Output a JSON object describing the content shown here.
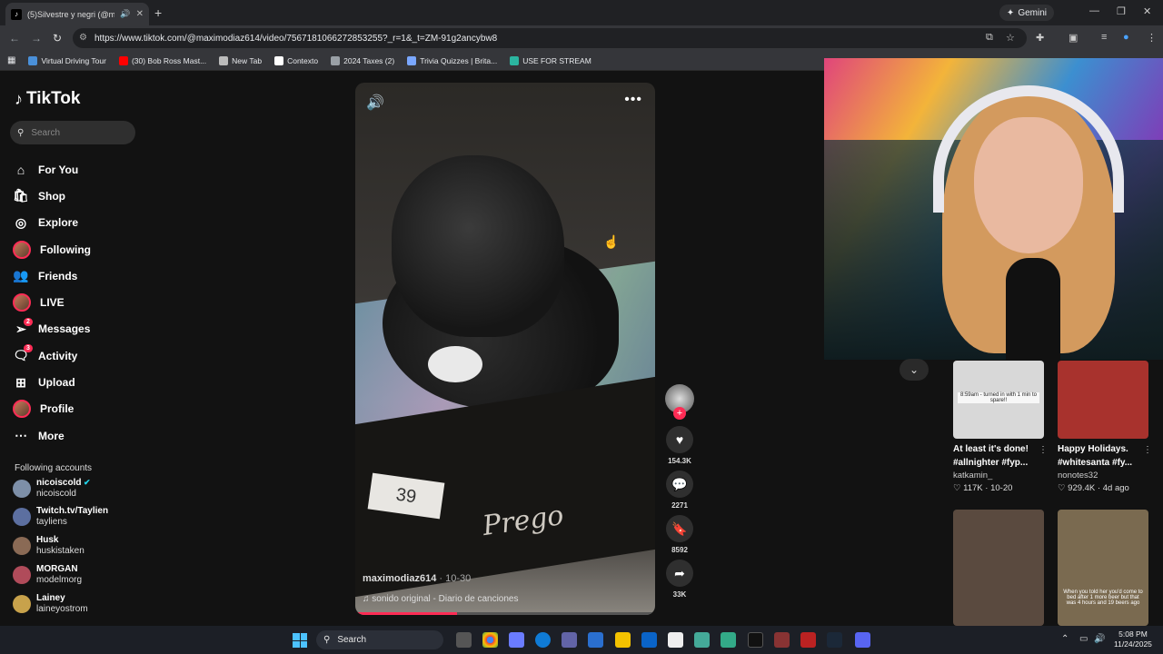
{
  "browser": {
    "tab_title": "(5)Silvestre y negri (@maxim",
    "gemini_label": "Gemini",
    "url": "https://www.tiktok.com/@maximodiaz614/video/7567181066272853255?_r=1&_t=ZM-91g2ancybw8",
    "bookmarks": [
      {
        "label": "Virtual Driving Tour",
        "color": "#4a90d9"
      },
      {
        "label": "(30) Bob Ross Mast...",
        "color": "#ff0000"
      },
      {
        "label": "New Tab",
        "color": "#bbbbbb"
      },
      {
        "label": "Contexto",
        "color": "#ffffff"
      },
      {
        "label": "2024 Taxes (2)",
        "color": "#9aa0a6"
      },
      {
        "label": "Trivia Quizzes | Brita...",
        "color": "#7aa7ff"
      },
      {
        "label": "USE FOR STREAM",
        "color": "#2bb5a0"
      }
    ]
  },
  "sidebar": {
    "logo": "TikTok",
    "search_placeholder": "Search",
    "nav": [
      {
        "label": "For You",
        "icon": "home-icon",
        "glyph": "⌂"
      },
      {
        "label": "Shop",
        "icon": "shop-icon",
        "glyph": "🛍"
      },
      {
        "label": "Explore",
        "icon": "compass-icon",
        "glyph": "◎"
      },
      {
        "label": "Following",
        "icon": "avatar",
        "glyph": ""
      },
      {
        "label": "Friends",
        "icon": "friends-icon",
        "glyph": "👥"
      },
      {
        "label": "LIVE",
        "icon": "avatar",
        "glyph": ""
      },
      {
        "label": "Messages",
        "icon": "messages-icon",
        "glyph": "➢",
        "badge": "2"
      },
      {
        "label": "Activity",
        "icon": "activity-icon",
        "glyph": "🗨",
        "badge": "3"
      },
      {
        "label": "Upload",
        "icon": "upload-icon",
        "glyph": "⊞"
      },
      {
        "label": "Profile",
        "icon": "avatar",
        "glyph": ""
      },
      {
        "label": "More",
        "icon": "more-icon",
        "glyph": "⋯"
      }
    ],
    "following_title": "Following accounts",
    "accounts": [
      {
        "name": "nicoiscold",
        "handle": "nicoiscold",
        "verified": true,
        "color": "#7d8fa8"
      },
      {
        "name": "Twitch.tv/Taylien",
        "handle": "tayliens",
        "verified": false,
        "color": "#5c6fa0"
      },
      {
        "name": "Husk",
        "handle": "huskistaken",
        "verified": false,
        "color": "#8a6a55"
      },
      {
        "name": "MORGAN",
        "handle": "modelmorg",
        "verified": false,
        "color": "#b04b5a"
      },
      {
        "name": "Lainey",
        "handle": "laineyostrom",
        "verified": false,
        "color": "#c8a24b"
      }
    ]
  },
  "video": {
    "username": "maximodiaz614",
    "date": "10-30",
    "sound": "sonido original - Diario de canciones",
    "box_number": "39",
    "box_brand": "Prego",
    "progress": 0.34,
    "likes": "154.3K",
    "comments": "2271",
    "saves": "8592",
    "shares": "33K"
  },
  "recommendations": [
    {
      "caption": "At least it's done! #allnighter #fyp...",
      "author": "katkamin_",
      "likes": "117K",
      "date": "10-20",
      "thumb_text": "8:59am - turned in with 1 min to spare!!",
      "thumb_color": "#d8d8d8"
    },
    {
      "caption": "Happy Holidays. #whitesanta #fy...",
      "author": "nonotes32",
      "likes": "929.4K",
      "date": "4d ago",
      "thumb_text": "",
      "thumb_color": "#a8322d"
    },
    {
      "caption": "",
      "author": "",
      "likes": "",
      "date": "",
      "thumb_text": "",
      "thumb_color": "#5a4a3f"
    },
    {
      "caption": "",
      "author": "",
      "likes": "",
      "date": "",
      "thumb_text": "When you told her you'd come to bed after 1 more beer but that was 4 hours and 19 beers ago",
      "thumb_color": "#7a6a50"
    }
  ],
  "taskbar": {
    "search_label": "Search",
    "time": "5:08 PM",
    "date": "11/24/2025"
  }
}
